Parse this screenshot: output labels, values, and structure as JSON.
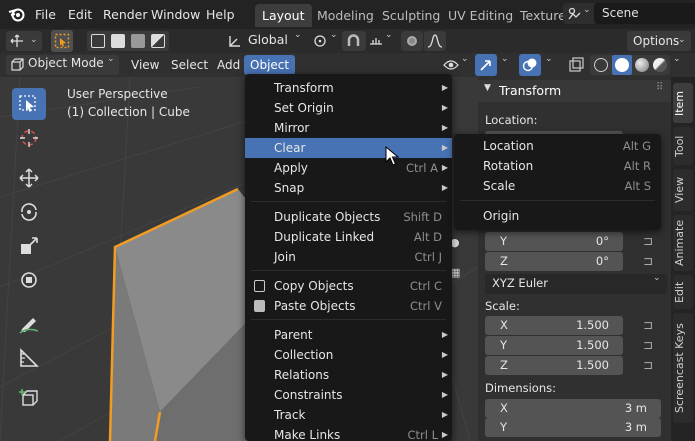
{
  "colors": {
    "accent": "#4772b3",
    "selection_orange": "#f19c22",
    "bg": "#1d1d1d"
  },
  "topbar": {
    "menus": [
      "File",
      "Edit",
      "Render",
      "Window",
      "Help"
    ],
    "tabs": [
      "Layout",
      "Modeling",
      "Sculpting",
      "UV Editing",
      "Texture"
    ],
    "scene": "Scene"
  },
  "toolbar": {
    "transform_orientation": "Global",
    "options": "Options"
  },
  "header": {
    "mode": "Object Mode",
    "view": "View",
    "select": "Select",
    "add": "Add",
    "object": "Object"
  },
  "viewport": {
    "perspective": "User Perspective",
    "collection": "(1) Collection | Cube"
  },
  "object_menu": {
    "items": [
      {
        "label": "Transform",
        "shortcut": "",
        "submenu": true
      },
      {
        "label": "Set Origin",
        "shortcut": "",
        "submenu": true
      },
      {
        "label": "Mirror",
        "shortcut": "",
        "submenu": true
      },
      {
        "label": "Clear",
        "shortcut": "",
        "submenu": true
      },
      {
        "label": "Apply",
        "shortcut": "Ctrl A",
        "submenu": true
      },
      {
        "label": "Snap",
        "shortcut": "",
        "submenu": true
      },
      {
        "label": "Duplicate Objects",
        "shortcut": "Shift D",
        "submenu": false
      },
      {
        "label": "Duplicate Linked",
        "shortcut": "Alt D",
        "submenu": false
      },
      {
        "label": "Join",
        "shortcut": "Ctrl J",
        "submenu": false
      },
      {
        "label": "Copy Objects",
        "shortcut": "Ctrl C",
        "submenu": false
      },
      {
        "label": "Paste Objects",
        "shortcut": "Ctrl V",
        "submenu": false
      },
      {
        "label": "Parent",
        "shortcut": "",
        "submenu": true
      },
      {
        "label": "Collection",
        "shortcut": "",
        "submenu": true
      },
      {
        "label": "Relations",
        "shortcut": "",
        "submenu": true
      },
      {
        "label": "Constraints",
        "shortcut": "",
        "submenu": true
      },
      {
        "label": "Track",
        "shortcut": "",
        "submenu": true
      },
      {
        "label": "Make Links",
        "shortcut": "Ctrl L",
        "submenu": true
      }
    ]
  },
  "clear_menu": {
    "items": [
      {
        "label": "Location",
        "shortcut": "Alt G"
      },
      {
        "label": "Rotation",
        "shortcut": "Alt R"
      },
      {
        "label": "Scale",
        "shortcut": "Alt S"
      },
      {
        "label": "Origin",
        "shortcut": ""
      }
    ]
  },
  "properties": {
    "title": "Transform",
    "location_label": "Location:",
    "rotation": {
      "y_label": "Y",
      "y_value": "0°",
      "z_label": "Z",
      "z_value": "0°"
    },
    "rotation_mode": "XYZ Euler",
    "scale_label": "Scale:",
    "scale": [
      {
        "axis": "X",
        "value": "1.500"
      },
      {
        "axis": "Y",
        "value": "1.500"
      },
      {
        "axis": "Z",
        "value": "1.500"
      }
    ],
    "dimensions_label": "Dimensions:",
    "dimensions": [
      {
        "axis": "X",
        "value": "3 m"
      },
      {
        "axis": "Y",
        "value": "3 m"
      }
    ]
  },
  "side_tabs": [
    "Item",
    "Tool",
    "View",
    "Animate",
    "Edit",
    "Screencast Keys"
  ]
}
